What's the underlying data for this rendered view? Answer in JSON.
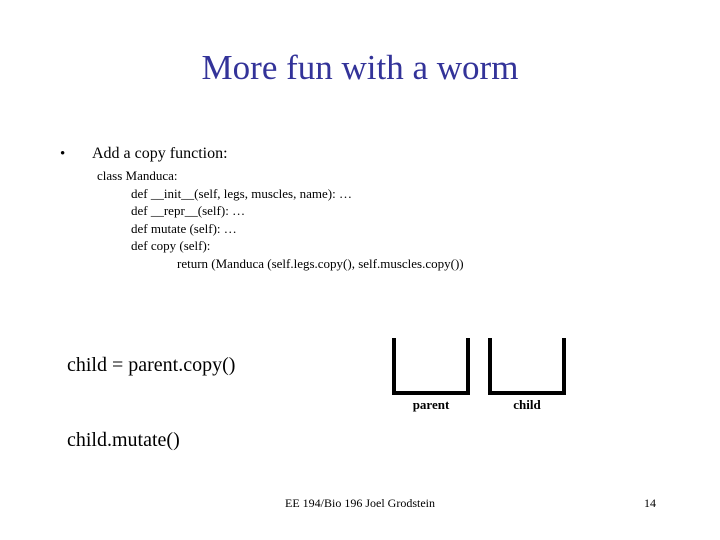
{
  "slide": {
    "title": "More fun with a worm",
    "title_color": "#333399",
    "background_color": "#ffffff",
    "text_color": "#000000"
  },
  "bullet": {
    "marker": "•",
    "text": "Add a copy function:"
  },
  "code_block": [
    {
      "indent": 0,
      "text": "class Manduca:"
    },
    {
      "indent": 1,
      "text": "def __init__(self, legs, muscles, name): …"
    },
    {
      "indent": 1,
      "text": "def __repr__(self): …"
    },
    {
      "indent": 1,
      "text": "def mutate (self): …"
    },
    {
      "indent": 1,
      "text": "def copy (self):"
    },
    {
      "indent": 2,
      "text": "return (Manduca (self.legs.copy(), self.muscles.copy())"
    }
  ],
  "usage_code": [
    "child = parent.copy()",
    "child.mutate()"
  ],
  "diagram": {
    "boxes": [
      {
        "label": "parent"
      },
      {
        "label": "child"
      }
    ]
  },
  "footer": {
    "text": "EE 194/Bio 196 Joel Grodstein",
    "page_number": "14"
  }
}
